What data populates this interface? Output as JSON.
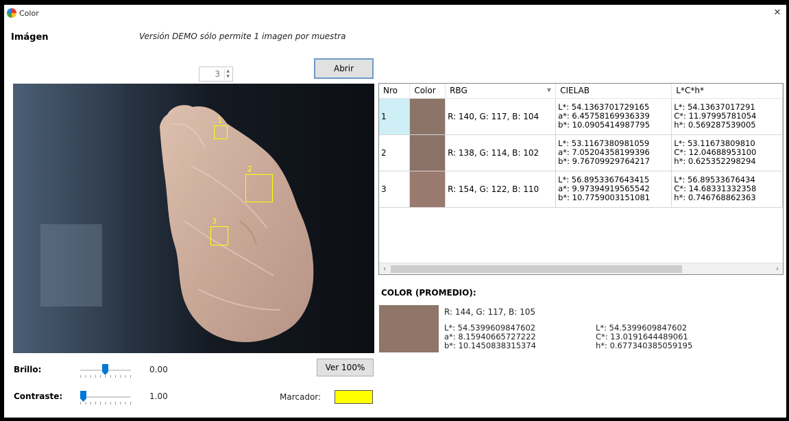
{
  "window": {
    "title": "Color",
    "close_glyph": "✕"
  },
  "header": {
    "image_label": "Imágen",
    "demo_note": "Versión DEMO sólo permite 1 imagen por muestra",
    "spinner_value": "3",
    "open_button": "Abrir"
  },
  "image": {
    "markers": [
      {
        "label": "1"
      },
      {
        "label": "2"
      },
      {
        "label": "3"
      }
    ]
  },
  "controls": {
    "brightness_label": "Brillo:",
    "brightness_value": "0.00",
    "contrast_label": "Contraste:",
    "contrast_value": "1.00",
    "view100_button": "Ver 100%",
    "marker_label": "Marcador:",
    "marker_color": "#ffff00"
  },
  "table": {
    "columns": [
      "Nro",
      "Color",
      "RBG",
      "CIELAB",
      "L*C*h*"
    ],
    "rows": [
      {
        "nro": "1",
        "color": "#8c7568",
        "rgb": "R: 140, G: 117, B: 104",
        "lab": [
          "L*: 54.1363701729165",
          "a*: 6.45758169936339",
          "b*: 10.0905414987795"
        ],
        "lch": [
          "L*: 54.13637017291",
          "C*: 11.97995781054",
          "h*: 0.569287539005"
        ]
      },
      {
        "nro": "2",
        "color": "#8a7266",
        "rgb": "R: 138, G: 114, B: 102",
        "lab": [
          "L*: 53.1167380981059",
          "a*: 7.05204358199396",
          "b*: 9.76709929764217"
        ],
        "lch": [
          "L*: 53.11673809810",
          "C*: 12.04688953100",
          "h*: 0.625352298294"
        ]
      },
      {
        "nro": "3",
        "color": "#9a7a6e",
        "rgb": "R: 154, G: 122, B: 110",
        "lab": [
          "L*: 56.8953367643415",
          "a*: 9.97394919565542",
          "b*: 10.7759003151081"
        ],
        "lch": [
          "L*: 56.89533676434",
          "C*: 14.68331332358",
          "h*: 0.746768862363"
        ]
      }
    ]
  },
  "average": {
    "title": "COLOR (PROMEDIO):",
    "color": "#907569",
    "rgb": "R: 144, G: 117, B: 105",
    "lab": [
      "L*: 54.5399609847602",
      "a*: 8.15940665727222",
      "b*: 10.1450838315374"
    ],
    "lch": [
      "L*: 54.5399609847602",
      "C*: 13.0191644489061",
      "h*: 0.677340385059195"
    ]
  }
}
